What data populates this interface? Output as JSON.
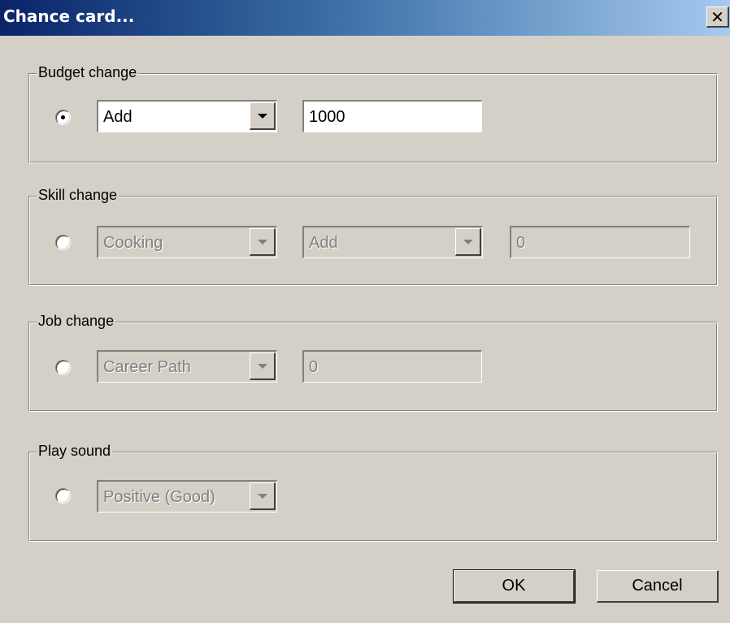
{
  "window": {
    "title": "Chance card...",
    "close_glyph": "✕"
  },
  "groups": {
    "budget": {
      "label": "Budget change",
      "selected": true,
      "operation": "Add",
      "amount": "1000"
    },
    "skill": {
      "label": "Skill change",
      "selected": false,
      "skill": "Cooking",
      "operation": "Add",
      "amount": "0"
    },
    "job": {
      "label": "Job change",
      "selected": false,
      "job": "Career Path",
      "amount": "0"
    },
    "sound": {
      "label": "Play sound",
      "selected": false,
      "sound": "Positive (Good)"
    }
  },
  "buttons": {
    "ok": "OK",
    "cancel": "Cancel"
  },
  "colors": {
    "face": "#d4d0c8",
    "title_start": "#0a246a",
    "title_end": "#a6caf0",
    "disabled_text": "#808080"
  }
}
